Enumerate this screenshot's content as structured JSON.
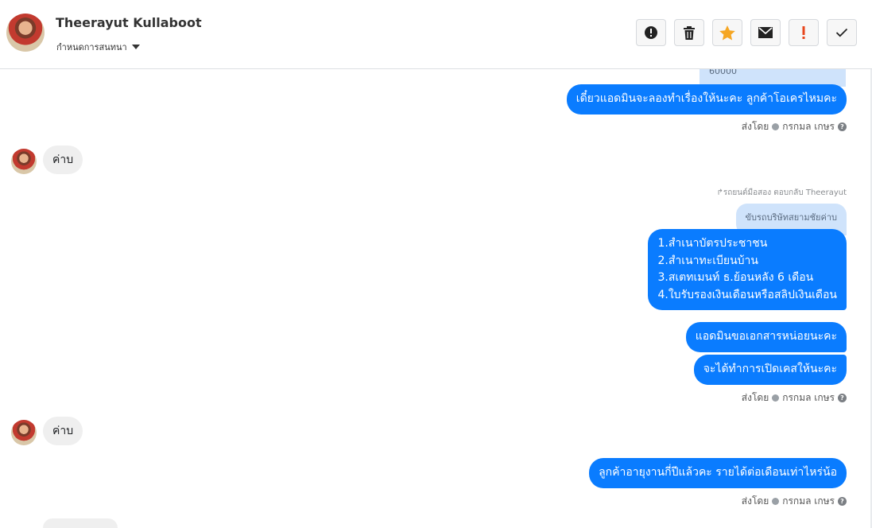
{
  "header": {
    "contact_name": "Theerayut Kullaboot",
    "subtitle": "กำหนดการสนทนา",
    "buttons": [
      {
        "name": "report-button",
        "icon": "alert-circle-icon"
      },
      {
        "name": "delete-button",
        "icon": "trash-icon"
      },
      {
        "name": "star-button",
        "icon": "star-icon",
        "color": "#f5a623"
      },
      {
        "name": "mail-button",
        "icon": "envelope-icon"
      },
      {
        "name": "spam-button",
        "icon": "exclamation-icon",
        "color": "#e8461c"
      },
      {
        "name": "done-button",
        "icon": "checkmark-icon"
      }
    ]
  },
  "messages": {
    "top_reply_preview": "60000",
    "out_1": "เดี๋ยวแอดมินจะลองทำเรื่องให้นะคะ ลูกค้าโอเครไหมคะ",
    "sent_by_1": "ส่งโดย",
    "sender_name_1": "กรกมล เกษร",
    "in_1": "ค่าบ",
    "reply_note": "รถยนต์มือสอง ตอบกลับ Theerayut",
    "reply_quote": "ขับรถบริษัทสยามชัยค่าบ",
    "out_list": [
      "1.สำเนาบัตรประชาชน",
      "2.สำเนาทะเบียนบ้าน",
      "3.สเตทเมนท์ ธ.ย้อนหลัง 6 เดือน",
      "4.ใบรับรองเงินเดือนหรือสลิปเงินเดือน"
    ],
    "out_2": "แอดมินขอเอกสารหน่อยนะคะ",
    "out_3": "จะได้ทำการเปิดเคสให้นะคะ",
    "sent_by_2": "ส่งโดย",
    "sender_name_2": "กรกมล เกษร",
    "in_2": "ค่าบ",
    "out_4": "ลูกค้าอายุงานกี่ปีแล้วคะ รายได้ต่อเดือนเท่าไหร่น้อ",
    "sent_by_3": "ส่งโดย",
    "sender_name_3": "กรกมล เกษร",
    "help_glyph": "?"
  },
  "colors": {
    "outgoing_bubble": "#0a7cff",
    "incoming_bubble": "#efefef",
    "reply_bubble": "#cfe3fb"
  }
}
